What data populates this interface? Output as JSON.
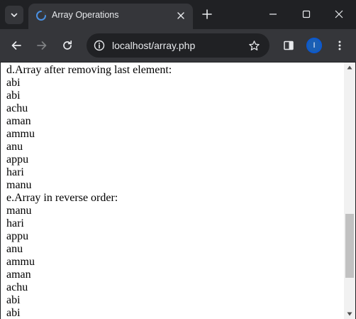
{
  "tab": {
    "title": "Array Operations"
  },
  "address_bar": {
    "url": "localhost/array.php"
  },
  "profile": {
    "initial": "I"
  },
  "page": {
    "lines": [
      "d.Array after removing last element:",
      "abi",
      "abi",
      "achu",
      "aman",
      "ammu",
      "anu",
      "appu",
      "hari",
      "manu",
      "e.Array in reverse order:",
      "manu",
      "hari",
      "appu",
      "anu",
      "ammu",
      "aman",
      "achu",
      "abi",
      "abi"
    ]
  },
  "scrollbar": {
    "position_fraction": 0.82
  },
  "icons": {
    "tab_search": "chevron-down-icon",
    "favicon": "loading-favicon-icon",
    "tab_close": "close-icon",
    "new_tab": "plus-icon",
    "minimize": "minimize-icon",
    "maximize": "maximize-icon",
    "close_window": "close-icon",
    "back": "arrow-left-icon",
    "forward": "arrow-right-icon",
    "reload": "reload-icon",
    "site_info": "info-icon",
    "bookmark": "star-icon",
    "side_panel": "side-panel-icon",
    "menu": "kebab-menu-icon"
  },
  "colors": {
    "frame": "#202124",
    "toolbar": "#35363a",
    "page_background": "#ffffff",
    "text": "#000000",
    "avatar": "#1a5fb4"
  }
}
